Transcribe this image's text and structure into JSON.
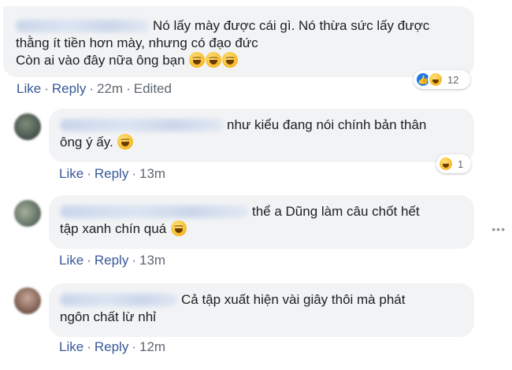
{
  "comments": [
    {
      "lines": [
        "Nó lấy mày được cái gì. Nó thừa sức lấy được",
        "thằng ít tiền hơn mày, nhưng có đạo đức",
        "Còn ai vào đây nữa ông bạn"
      ],
      "actions": {
        "like": "Like",
        "reply": "Reply",
        "time": "22m",
        "edited": "Edited"
      },
      "reaction_count": "12",
      "reactions": [
        "like-icon",
        "haha-icon"
      ]
    },
    {
      "lines": [
        "như kiểu đang nói chính bản thân",
        "ông ý ấy."
      ],
      "actions": {
        "like": "Like",
        "reply": "Reply",
        "time": "13m"
      },
      "reaction_count": "1",
      "reactions": [
        "haha-icon"
      ]
    },
    {
      "lines": [
        "thể a Dũng làm câu chốt hết",
        "tập xanh chín quá"
      ],
      "actions": {
        "like": "Like",
        "reply": "Reply",
        "time": "13m"
      }
    },
    {
      "lines": [
        "Cả tập xuất hiện vài giây thôi mà phát",
        "ngôn chất lừ nhỉ"
      ],
      "actions": {
        "like": "Like",
        "reply": "Reply",
        "time": "12m"
      }
    }
  ],
  "separator": "·",
  "colors": {
    "bubble": "#f2f3f5",
    "link": "#385898",
    "meta": "#606770",
    "text": "#1c1e21"
  }
}
